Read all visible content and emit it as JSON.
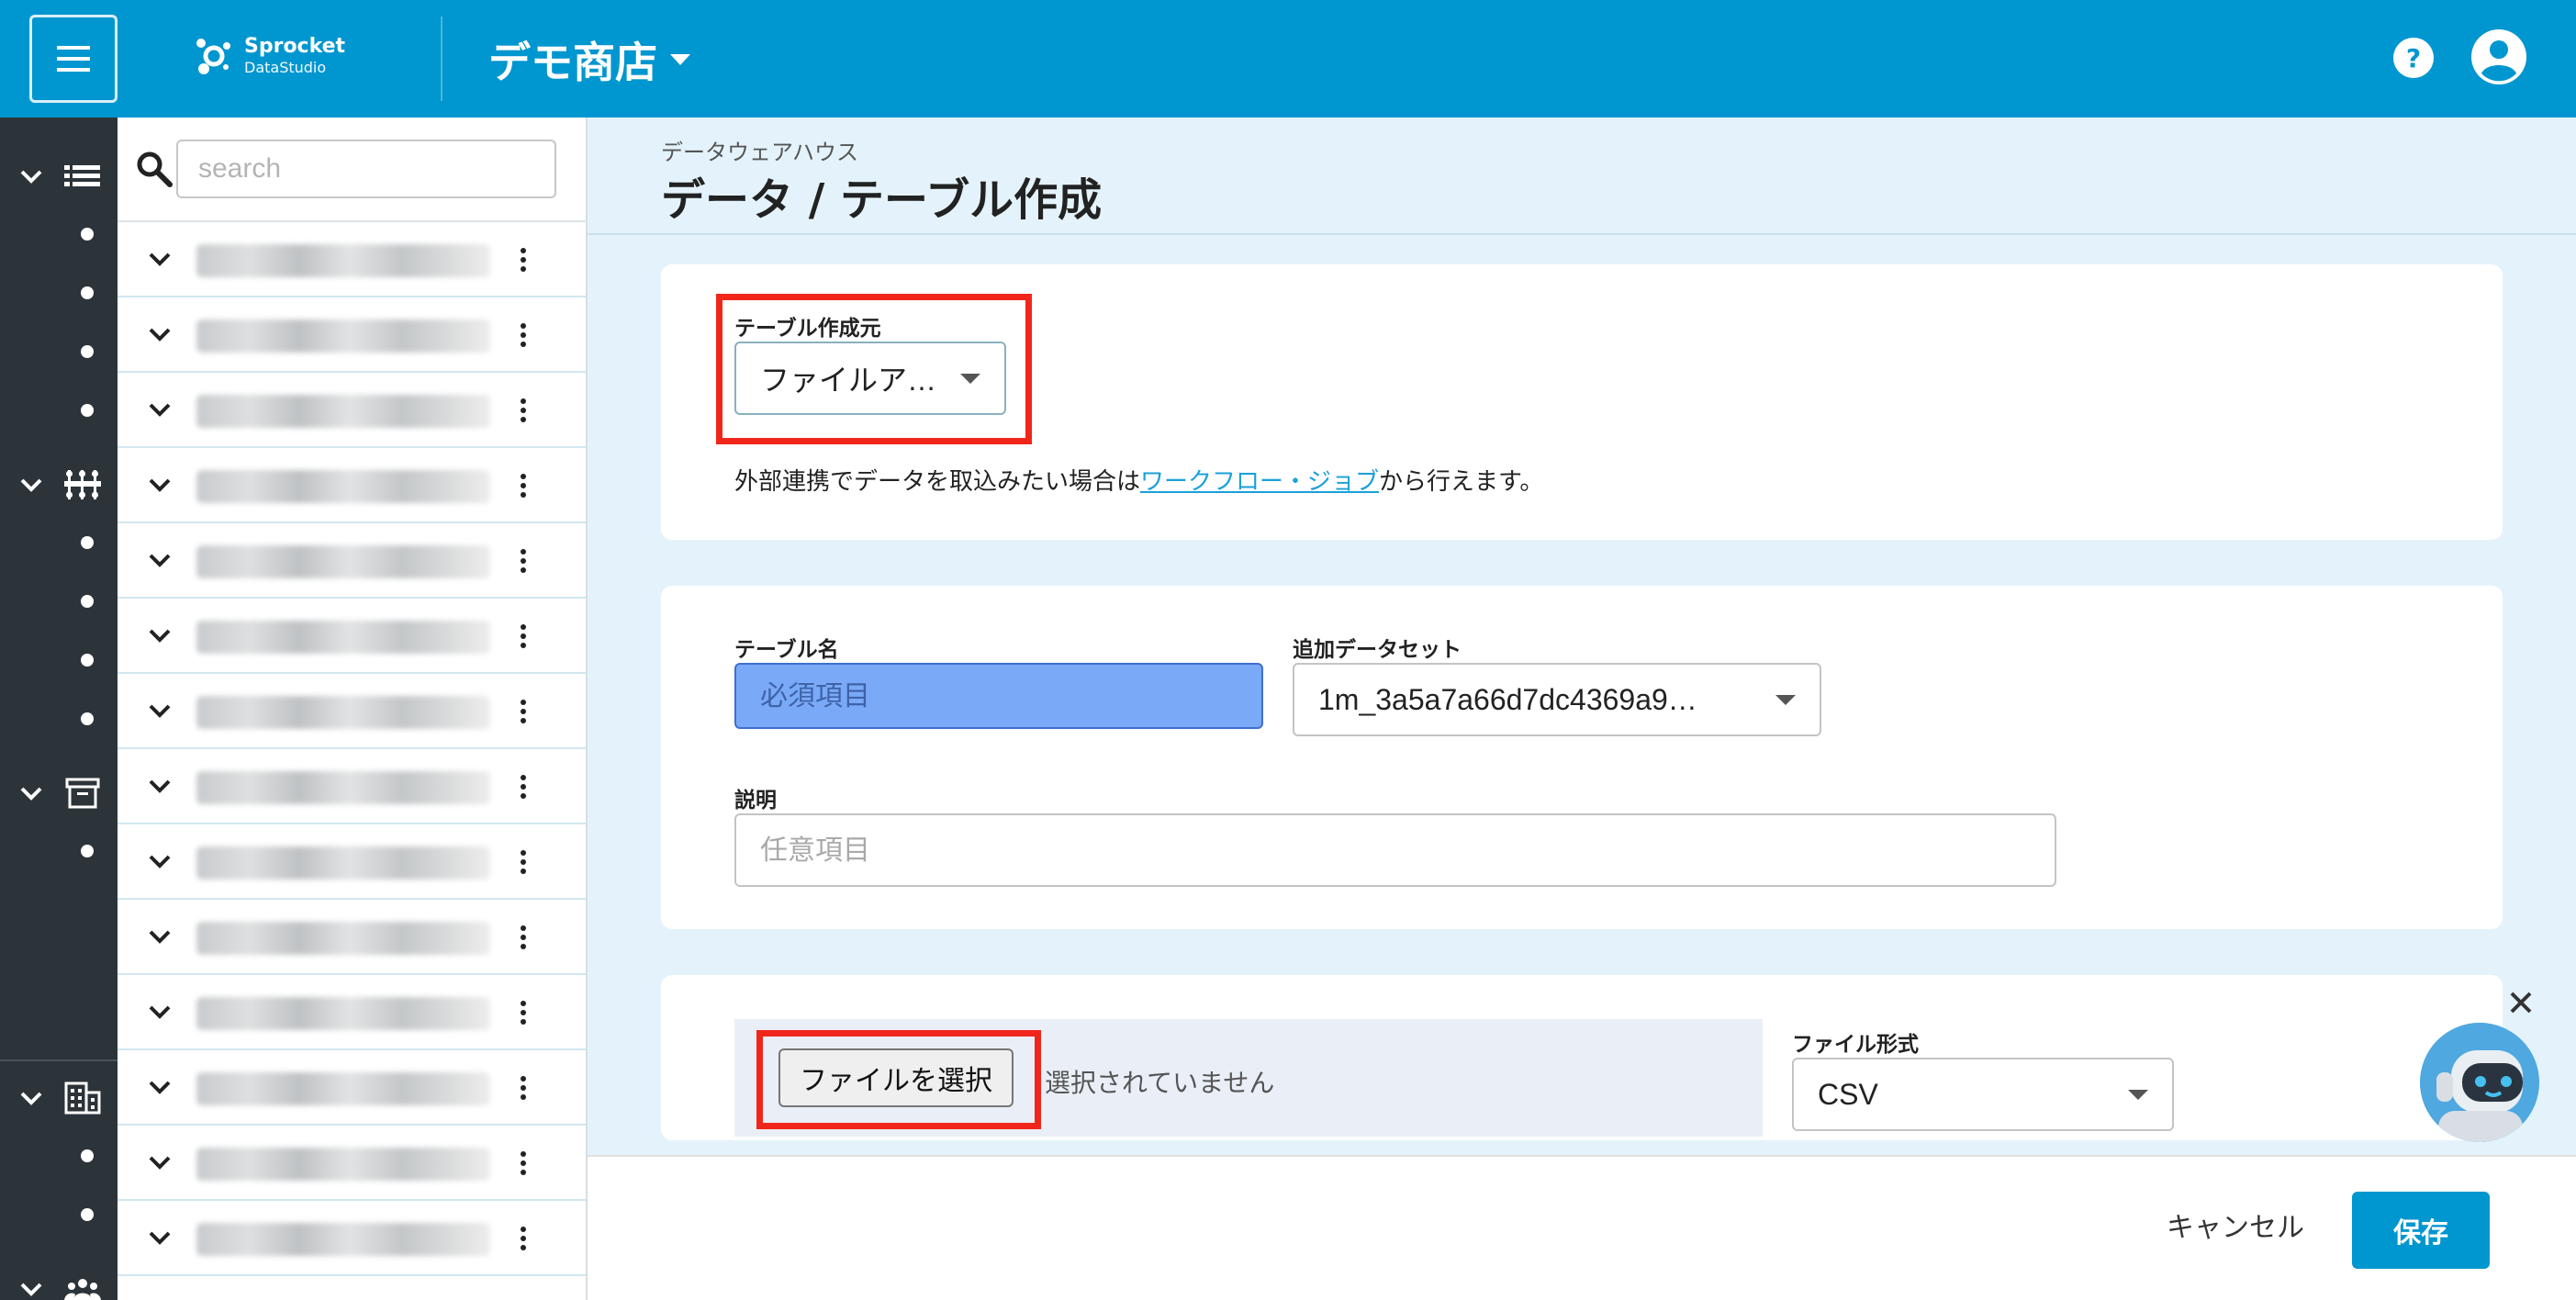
{
  "header": {
    "logo_main": "Sprocket",
    "logo_sub": "DataStudio",
    "store_name": "デモ商店",
    "colors": {
      "header_bg": "#0096cf",
      "rail_bg": "#2c343a"
    }
  },
  "search": {
    "placeholder": "search"
  },
  "tree": {
    "rows": [
      {
        "name": ""
      },
      {
        "name": ""
      },
      {
        "name": ""
      },
      {
        "name": ""
      },
      {
        "name": ""
      },
      {
        "name": ""
      },
      {
        "name": ""
      },
      {
        "name": ""
      },
      {
        "name": ""
      },
      {
        "name": ""
      },
      {
        "name": ""
      },
      {
        "name": ""
      },
      {
        "name": ""
      },
      {
        "name": ""
      }
    ]
  },
  "page": {
    "breadcrumb": "データウェアハウス",
    "title": "データ / テーブル作成"
  },
  "source": {
    "label": "テーブル作成元",
    "value": "ファイルアップロード",
    "hint_before": "外部連携でデータを取込みたい場合は",
    "hint_link": "ワークフロー・ジョブ",
    "hint_after": "から行えます。"
  },
  "table": {
    "name_label": "テーブル名",
    "name_placeholder": "必須項目",
    "dataset_label": "追加データセット",
    "dataset_value": "1m_3a5a7a66d7dc4369a9…",
    "desc_label": "説明",
    "desc_placeholder": "任意項目"
  },
  "file": {
    "choose_label": "ファイルを選択",
    "status": "選択されていません",
    "format_label": "ファイル形式",
    "format_value": "CSV"
  },
  "footer": {
    "cancel": "キャンセル",
    "save": "保存"
  },
  "accent": {
    "highlight_red": "#f0261b",
    "link_blue": "#1aa0d8"
  }
}
